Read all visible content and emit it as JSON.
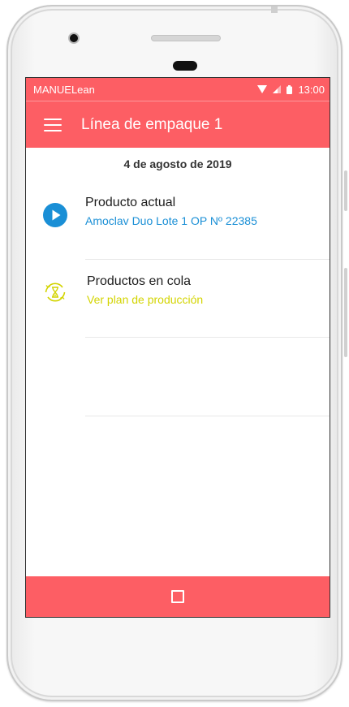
{
  "status_bar": {
    "app_name": "MANUELean",
    "time": "13:00",
    "icons": [
      "wifi-icon",
      "signal-icon",
      "battery-icon"
    ]
  },
  "app_bar": {
    "title": "Línea de empaque 1",
    "menu_icon": "hamburger-menu-icon"
  },
  "date": "4 de agosto de 2019",
  "rows": [
    {
      "title": "Producto actual",
      "subtitle": "Amoclav Duo Lote 1 OP Nº 22385",
      "icon": "play-icon",
      "subtitle_color": "#1a8fd6"
    },
    {
      "title": "Productos en cola",
      "subtitle": "Ver plan de producción",
      "icon": "hourglass-icon",
      "subtitle_color": "#d3d400"
    }
  ],
  "nav_bar": {
    "button": "home-square-icon"
  },
  "colors": {
    "accent": "#fd5e64",
    "play_blue": "#1a8fd6",
    "queue_yellow": "#d3d400"
  }
}
